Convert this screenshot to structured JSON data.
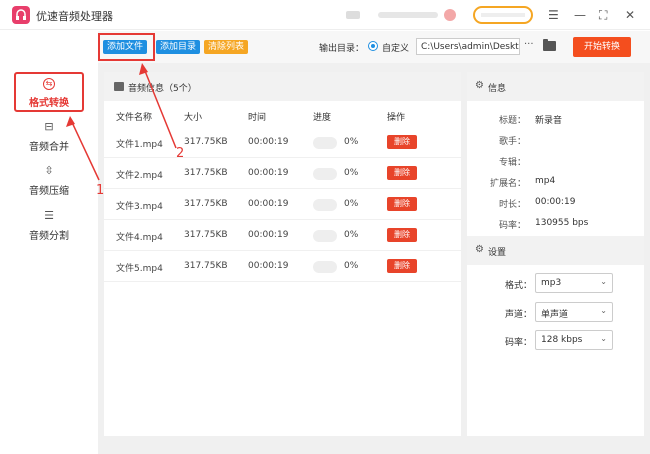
{
  "app": {
    "title": "优速音频处理器"
  },
  "titlebar": {
    "controls": [
      "menu-icon",
      "minimize-icon",
      "maximize-icon",
      "close-icon"
    ]
  },
  "sidebar": {
    "items": [
      {
        "label": "格式转换",
        "icon": "convert-icon",
        "active": true
      },
      {
        "label": "音频合并",
        "icon": "merge-icon"
      },
      {
        "label": "音频压缩",
        "icon": "compress-icon"
      },
      {
        "label": "音频分割",
        "icon": "split-icon"
      }
    ]
  },
  "toolbar": {
    "add_file": "添加文件",
    "add_folder": "添加目录",
    "clear_list": "清除列表",
    "output_label": "输出目录：",
    "radio_label": "自定义",
    "output_path": "C:\\Users\\admin\\Deskto",
    "more": "···",
    "start": "开始转换"
  },
  "filelist": {
    "header": "音频信息（5个）",
    "columns": [
      "文件名称",
      "大小",
      "时间",
      "进度",
      "操作"
    ],
    "rows": [
      {
        "name": "文件1.mp4",
        "size": "317.75KB",
        "time": "00:00:19",
        "progress": "0%",
        "action": "删除"
      },
      {
        "name": "文件2.mp4",
        "size": "317.75KB",
        "time": "00:00:19",
        "progress": "0%",
        "action": "删除"
      },
      {
        "name": "文件3.mp4",
        "size": "317.75KB",
        "time": "00:00:19",
        "progress": "0%",
        "action": "删除"
      },
      {
        "name": "文件4.mp4",
        "size": "317.75KB",
        "time": "00:00:19",
        "progress": "0%",
        "action": "删除"
      },
      {
        "name": "文件5.mp4",
        "size": "317.75KB",
        "time": "00:00:19",
        "progress": "0%",
        "action": "删除"
      }
    ]
  },
  "info": {
    "title": "信息",
    "rows": [
      {
        "key": "标题：",
        "value": "新录音"
      },
      {
        "key": "歌手：",
        "value": ""
      },
      {
        "key": "专辑：",
        "value": ""
      },
      {
        "key": "扩展名：",
        "value": "mp4"
      },
      {
        "key": "时长：",
        "value": "00:00:19"
      },
      {
        "key": "码率：",
        "value": "130955 bps"
      }
    ]
  },
  "settings": {
    "title": "设置",
    "rows": [
      {
        "key": "格式：",
        "value": "mp3"
      },
      {
        "key": "声道：",
        "value": "单声道"
      },
      {
        "key": "码率：",
        "value": "128 kbps"
      }
    ]
  },
  "annotations": {
    "one": "1",
    "two": "2"
  },
  "colors": {
    "accent_red": "#e53935",
    "blue": "#1e8fe1",
    "orange": "#f5a623",
    "start": "#f44e1e"
  }
}
